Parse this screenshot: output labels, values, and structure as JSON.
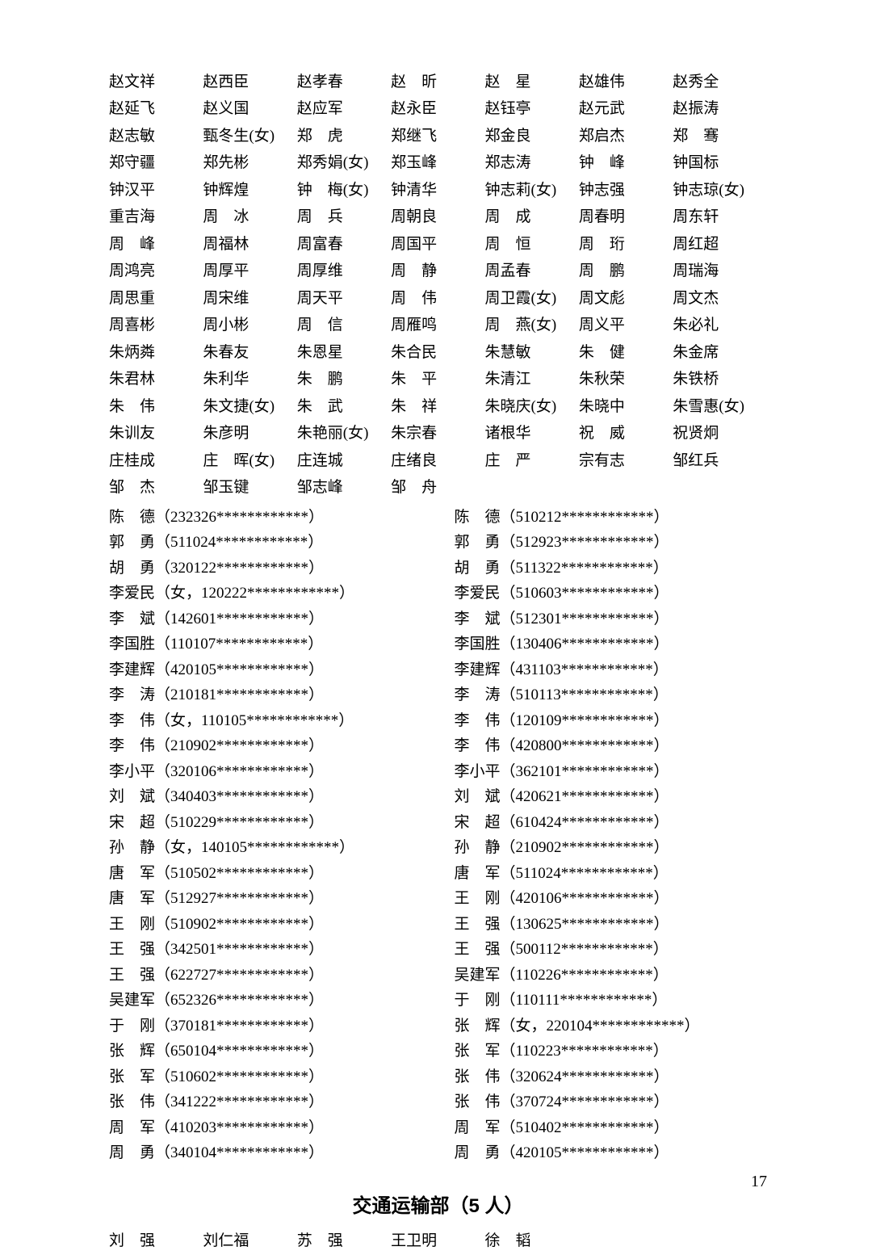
{
  "names_grid": [
    "赵文祥",
    "赵西臣",
    "赵孝春",
    "赵　昕",
    "赵　星",
    "赵雄伟",
    "赵秀全",
    "赵延飞",
    "赵义国",
    "赵应军",
    "赵永臣",
    "赵钰亭",
    "赵元武",
    "赵振涛",
    "赵志敏",
    "甄冬生(女)",
    "郑　虎",
    "郑继飞",
    "郑金良",
    "郑启杰",
    "郑　骞",
    "郑守疆",
    "郑先彬",
    "郑秀娟(女)",
    "郑玉峰",
    "郑志涛",
    "钟　峰",
    "钟国标",
    "钟汉平",
    "钟辉煌",
    "钟　梅(女)",
    "钟清华",
    "钟志莉(女)",
    "钟志强",
    "钟志琼(女)",
    "重吉海",
    "周　冰",
    "周　兵",
    "周朝良",
    "周　成",
    "周春明",
    "周东轩",
    "周　峰",
    "周福林",
    "周富春",
    "周国平",
    "周　恒",
    "周　珩",
    "周红超",
    "周鸿亮",
    "周厚平",
    "周厚维",
    "周　静",
    "周孟春",
    "周　鹏",
    "周瑞海",
    "周思重",
    "周宋维",
    "周天平",
    "周　伟",
    "周卫霞(女)",
    "周文彪",
    "周文杰",
    "周喜彬",
    "周小彬",
    "周　信",
    "周雁鸣",
    "周　燕(女)",
    "周义平",
    "朱必礼",
    "朱炳粦",
    "朱春友",
    "朱恩星",
    "朱合民",
    "朱慧敏",
    "朱　健",
    "朱金席",
    "朱君林",
    "朱利华",
    "朱　鹏",
    "朱　平",
    "朱清江",
    "朱秋荣",
    "朱铁桥",
    "朱　伟",
    "朱文捷(女)",
    "朱　武",
    "朱　祥",
    "朱晓庆(女)",
    "朱晓中",
    "朱雪惠(女)",
    "朱训友",
    "朱彦明",
    "朱艳丽(女)",
    "朱宗春",
    "诸根华",
    "祝　威",
    "祝贤炯",
    "庄桂成",
    "庄　晖(女)",
    "庄连城",
    "庄绪良",
    "庄　严",
    "宗有志",
    "邹红兵",
    "邹　杰",
    "邹玉键",
    "邹志峰",
    "邹　舟"
  ],
  "id_rows": [
    {
      "l": "陈　德（232326************）",
      "r": "陈　德（510212************）"
    },
    {
      "l": "郭　勇（511024************）",
      "r": "郭　勇（512923************）"
    },
    {
      "l": "胡　勇（320122************）",
      "r": "胡　勇（511322************）"
    },
    {
      "l": "李爱民（女，120222************）",
      "r": "李爱民（510603************）"
    },
    {
      "l": "李　斌（142601************）",
      "r": "李　斌（512301************）"
    },
    {
      "l": "李国胜（110107************）",
      "r": "李国胜（130406************）"
    },
    {
      "l": "李建辉（420105************）",
      "r": "李建辉（431103************）"
    },
    {
      "l": "李　涛（210181************）",
      "r": "李　涛（510113************）"
    },
    {
      "l": "李　伟（女，110105************）",
      "r": "李　伟（120109************）"
    },
    {
      "l": "李　伟（210902************）",
      "r": "李　伟（420800************）"
    },
    {
      "l": "李小平（320106************）",
      "r": "李小平（362101************）"
    },
    {
      "l": "刘　斌（340403************）",
      "r": "刘　斌（420621************）"
    },
    {
      "l": "宋　超（510229************）",
      "r": "宋　超（610424************）"
    },
    {
      "l": "孙　静（女，140105************）",
      "r": "孙　静（210902************）"
    },
    {
      "l": "唐　军（510502************）",
      "r": "唐　军（511024************）"
    },
    {
      "l": "唐　军（512927************）",
      "r": "王　刚（420106************）"
    },
    {
      "l": "王　刚（510902************）",
      "r": "王　强（130625************）"
    },
    {
      "l": "王　强（342501************）",
      "r": "王　强（500112************）"
    },
    {
      "l": "王　强（622727************）",
      "r": "吴建军（110226************）"
    },
    {
      "l": "吴建军（652326************）",
      "r": "于　刚（110111************）"
    },
    {
      "l": "于　刚（370181************）",
      "r": "张　辉（女，220104************）"
    },
    {
      "l": "张　辉（650104************）",
      "r": "张　军（110223************）"
    },
    {
      "l": "张　军（510602************）",
      "r": "张　伟（320624************）"
    },
    {
      "l": "张　伟（341222************）",
      "r": "张　伟（370724************）"
    },
    {
      "l": "周　军（410203************）",
      "r": "周　军（510402************）"
    },
    {
      "l": "周　勇（340104************）",
      "r": "周　勇（420105************）"
    }
  ],
  "section2": {
    "title": "交通运输部（5 人）",
    "names": [
      "刘　强",
      "刘仁福",
      "苏　强",
      "王卫明",
      "徐　韬"
    ]
  },
  "page_number": "17"
}
